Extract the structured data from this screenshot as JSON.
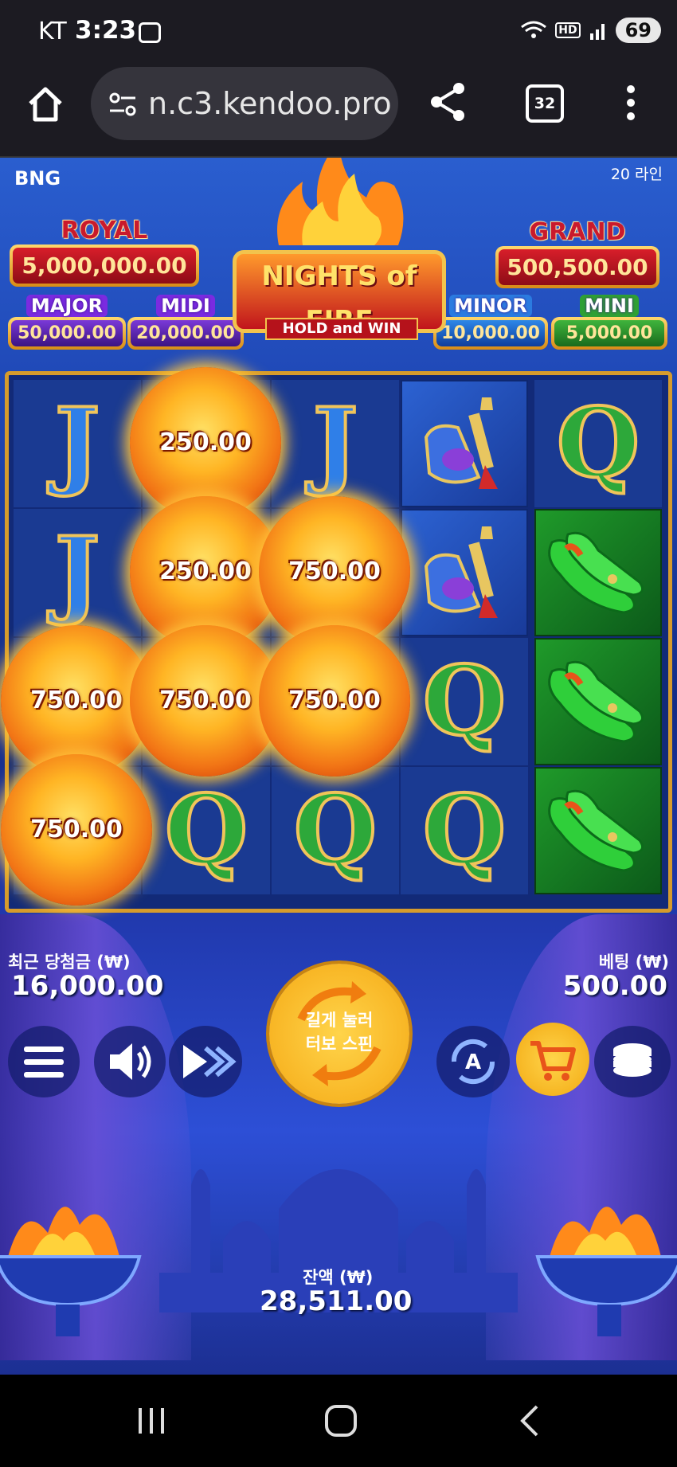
{
  "status_bar": {
    "carrier": "KT",
    "time": "3:23",
    "battery": "69"
  },
  "browser": {
    "url": "n.c3.kendoo.pro",
    "tab_count": "32"
  },
  "game": {
    "provider": "BNG",
    "lines": "20 라인",
    "logo": {
      "title": "NIGHTS of FIRE",
      "subtitle": "HOLD and WIN"
    },
    "jackpots": {
      "royal": {
        "label": "ROYAL",
        "value": "5,000,000.00"
      },
      "grand": {
        "label": "GRAND",
        "value": "500,500.00"
      },
      "major": {
        "label": "MAJOR",
        "value": "50,000.00"
      },
      "midi": {
        "label": "MIDI",
        "value": "20,000.00"
      },
      "minor": {
        "label": "MINOR",
        "value": "10,000.00"
      },
      "mini": {
        "label": "MINI",
        "value": "5,000.00"
      }
    },
    "grid": [
      [
        {
          "type": "J"
        },
        {
          "type": "orb",
          "value": "250.00"
        },
        {
          "type": "J"
        },
        {
          "type": "lamp"
        },
        {
          "type": "Q"
        }
      ],
      [
        {
          "type": "J"
        },
        {
          "type": "orb",
          "value": "250.00"
        },
        {
          "type": "orb",
          "value": "750.00"
        },
        {
          "type": "lamp"
        },
        {
          "type": "shoes"
        }
      ],
      [
        {
          "type": "orb",
          "value": "750.00"
        },
        {
          "type": "orb",
          "value": "750.00"
        },
        {
          "type": "orb",
          "value": "750.00"
        },
        {
          "type": "Q"
        },
        {
          "type": "shoes"
        }
      ],
      [
        {
          "type": "orb",
          "value": "750.00"
        },
        {
          "type": "Q"
        },
        {
          "type": "Q"
        },
        {
          "type": "Q"
        },
        {
          "type": "shoes"
        }
      ]
    ],
    "last_win": {
      "label": "최근 당첨금 (₩)",
      "value": "16,000.00"
    },
    "bet": {
      "label": "베팅 (₩)",
      "value": "500.00"
    },
    "spin_button": {
      "line1": "길게 눌러",
      "line2": "터보 스핀"
    },
    "balance": {
      "label": "잔액 (₩)",
      "value": "28,511.00"
    },
    "icons": [
      "menu-icon",
      "sound-icon",
      "fast-forward-icon",
      "autoplay-icon",
      "cart-icon",
      "coins-icon"
    ]
  }
}
